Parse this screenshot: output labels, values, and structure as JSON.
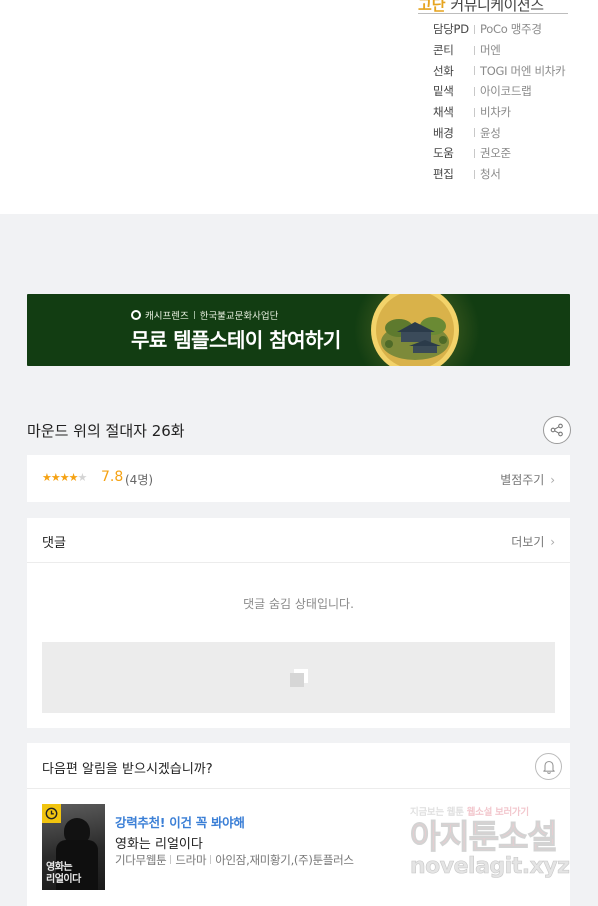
{
  "credits": {
    "publisher_accent": "고단",
    "publisher_rest": "커뮤니케이션즈",
    "rows": [
      {
        "role": "담당PD",
        "names": "PoCo 맹주경"
      },
      {
        "role": "콘티",
        "names": "머엔"
      },
      {
        "role": "선화",
        "names": "TOGI 머엔 비차카"
      },
      {
        "role": "밑색",
        "names": "아이코드랩"
      },
      {
        "role": "채색",
        "names": "비차카"
      },
      {
        "role": "배경",
        "names": "윤성"
      },
      {
        "role": "도움",
        "names": "권오준"
      },
      {
        "role": "편집",
        "names": "청서"
      }
    ]
  },
  "banner": {
    "brand": "캐시프렌즈",
    "partner": "한국불교문화사업단",
    "headline": "무료 템플스테이 참여하기"
  },
  "episode": {
    "title": "마운드 위의 절대자 26화"
  },
  "rating": {
    "filled_stars": 4,
    "total_stars": 5,
    "stars_filled_text": "★★★★",
    "stars_empty_text": "★",
    "score": "7.8",
    "votes": "(4명)",
    "rate_label": "별점주기"
  },
  "comments": {
    "title": "댓글",
    "more_label": "더보기",
    "hidden_message": "댓글 숨김 상태입니다."
  },
  "notify": {
    "question": "다음편 알림을 받으시겠습니까?"
  },
  "recommend": {
    "tag": "강력추천! 이건 꼭 봐야해",
    "title": "영화는 리얼이다",
    "category": "기다무웹툰",
    "genre": "드라마",
    "authors": "아인잠,재미황기,(주)툰플러스",
    "thumb_logo_line1": "영화는",
    "thumb_logo_line2": "리얼이다"
  },
  "watermark": {
    "line_top_left": "지금보는",
    "line_top_mid1": "웹툰",
    "line_top_mid2": "웹소설",
    "line_top_right": "보러가기",
    "main": "아지툰소설",
    "url": "novelagit.xyz"
  },
  "colors": {
    "accent_gold": "#e6a41f",
    "star": "#f5a213",
    "banner_bg": "#123d12",
    "link_blue": "#3b7fd6",
    "page_bg": "#f1f2f4"
  }
}
